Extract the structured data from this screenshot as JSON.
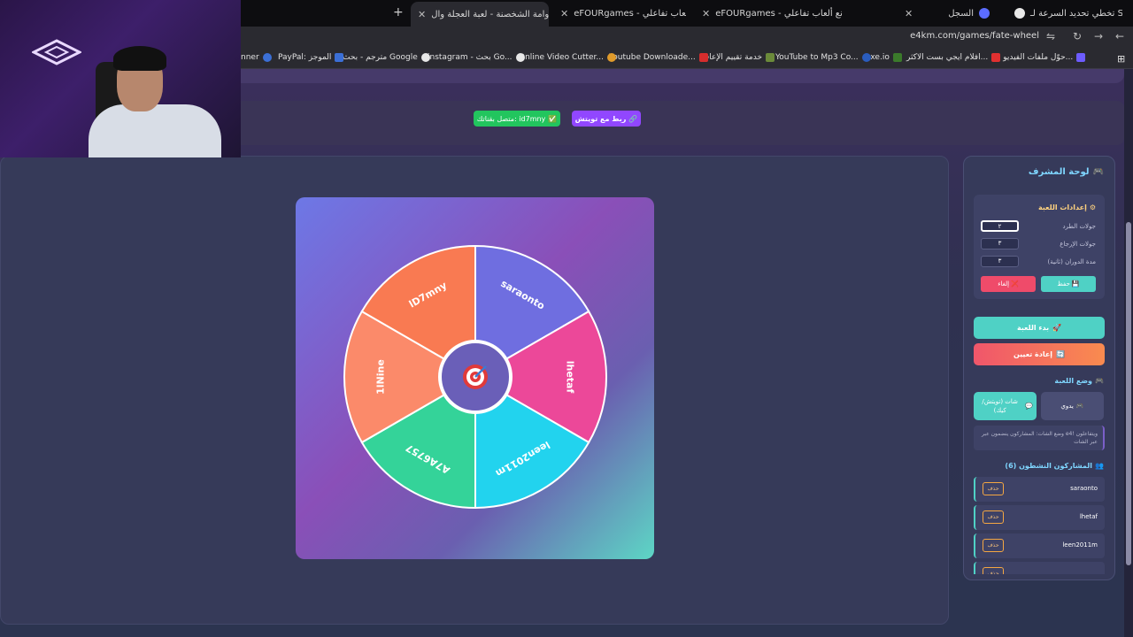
{
  "browser": {
    "tabs": [
      {
        "title": "تخطي تحديد السرعة لـ STC",
        "active": false
      },
      {
        "title": "السجل",
        "active": false
      },
      {
        "title": "eFOURgames - نع ألعاب تفاعلي",
        "active": false
      },
      {
        "title": "eFOURgames - نع ألعاب تفاعلي",
        "active": false
      },
      {
        "title": "دوامة الشخصنة - لعبة العجلة وال",
        "active": true
      }
    ],
    "new_tab": "+",
    "url": "e4km.com/games/fate-wheel",
    "bookmarks": [
      "حوّل ملفات الفيديو و...",
      "افلام ايجي بست الاكثر...",
      "exe.io",
      "YouTube to Mp3 Co...",
      "خدمة تقييم الإعاقة",
      "Youtube Downloade...",
      "Online Video Cutter...",
      "instagram - بحث Go...",
      "مترجم - بحث Google",
      "PayPal: الموجز",
      "nner"
    ]
  },
  "header": {
    "twitch_button": "ربط مع تويتش",
    "connected_button": "متصل بقناتك: id7mny"
  },
  "wheel": {
    "segments": [
      "saraonto",
      "lhetaf",
      "leen2011m",
      "A7A6757",
      "1lNine",
      "lD7mny"
    ],
    "colors": [
      "#6f6ee0",
      "#ec4899",
      "#22d3ee",
      "#34d399",
      "#fb8a6a",
      "#f97a52"
    ],
    "center_icon": "target-icon"
  },
  "admin": {
    "title": "لوحة المشرف",
    "settings": {
      "title": "إعدادات اللعبة",
      "rows": [
        {
          "label": "جولات الطرد",
          "value": "٢"
        },
        {
          "label": "جولات الإرجاع",
          "value": "٣"
        },
        {
          "label": "مدة الدوران (ثانية)",
          "value": "٣"
        }
      ],
      "save": "حفظ",
      "cancel": "إلغاء"
    },
    "start": "بدء اللعبة",
    "reset": "إعادة تعيين",
    "mode_title": "وضع اللعبة",
    "mode_manual": "يدوي",
    "mode_chat": "شات (تويتش/كيك)",
    "mode_desc": "وضع الشات: المشاركون ينضمون عبر e4! ويتفاعلون عبر الشات",
    "participants_title": "المشاركون النشطون (6)",
    "participants": [
      "saraonto",
      "lhetaf",
      "leen2011m",
      ""
    ],
    "delete_label": "حذف"
  }
}
